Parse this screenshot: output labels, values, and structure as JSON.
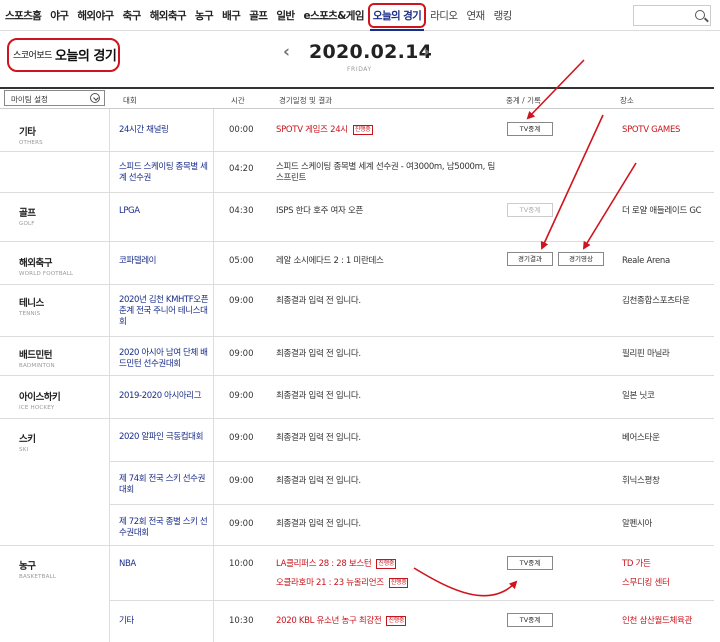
{
  "nav": {
    "items": [
      "스포츠홈",
      "야구",
      "해외야구",
      "축구",
      "해외축구",
      "농구",
      "배구",
      "골프",
      "일반",
      "e스포츠&게임"
    ],
    "active": "오늘의 경기",
    "after": [
      "라디오",
      "연재",
      "랭킹"
    ]
  },
  "header": {
    "scoreboard": "스코어보드",
    "title": "오늘의 경기",
    "date": "2020.02.14",
    "day": "FRIDAY"
  },
  "table": {
    "my_setting": "마이팀 설정",
    "columns": [
      "대회",
      "시간",
      "경기일정 및 결과",
      "중계 / 기록",
      "장소"
    ],
    "sports": [
      {
        "ko": "기타",
        "en": "OTHERS"
      },
      {
        "ko": "골프",
        "en": "GOLF"
      },
      {
        "ko": "해외축구",
        "en": "WORLD FOOTBALL"
      },
      {
        "ko": "테니스",
        "en": "TENNIS"
      },
      {
        "ko": "배드민턴",
        "en": "BADMINTON"
      },
      {
        "ko": "아이스하키",
        "en": "ICE HOCKEY"
      },
      {
        "ko": "스키",
        "en": "SKI"
      },
      {
        "ko": "농구",
        "en": "BASKETBALL"
      }
    ],
    "rows": [
      {
        "event": "24시간 채널링",
        "time": "00:00",
        "detail": "SPOTV 게임즈 24시",
        "live": "진행중",
        "button": "TV중계",
        "venue": "SPOTV GAMES"
      },
      {
        "event": "스피드 스케이팅 종목별 세계 선수권",
        "time": "04:20",
        "detail": "스피드 스케이팅 종목별 세계 선수권 - 여3000m, 남5000m, 팀스프린트",
        "venue": ""
      },
      {
        "event": "LPGA",
        "time": "04:30",
        "detail": "ISPS 한다 호주 여자 오픈",
        "button": "TV중계",
        "venue": "더 로얄 애들레이드 GC"
      },
      {
        "event": "코파델레이",
        "time": "05:00",
        "detail": "레알 소시에다드 2 : 1 미란데스",
        "button1": "경기결과",
        "button2": "경기영상",
        "venue": "Reale Arena"
      },
      {
        "event": "2020년 김천 KMHTF오픈 춘계 전국 주니어 테니스대회",
        "time": "09:00",
        "detail": "최종결과 입력 전 입니다.",
        "venue": "김천종합스포츠타운"
      },
      {
        "event": "2020 아시아 남여 단체 배드민턴 선수권대회",
        "time": "09:00",
        "detail": "최종결과 입력 전 입니다.",
        "venue": "필리핀 마닐라"
      },
      {
        "event": "2019-2020 아시아리그",
        "time": "09:00",
        "detail": "최종결과 입력 전 입니다.",
        "venue": "일본 닛코"
      },
      {
        "event": "2020 알파인 극동컵대회",
        "time": "09:00",
        "detail": "최종결과 입력 전 입니다.",
        "venue": "베어스타운"
      },
      {
        "event": "제 74회 전국 스키 선수권대회",
        "time": "09:00",
        "detail": "최종결과 입력 전 입니다.",
        "venue": "휘닉스평창"
      },
      {
        "event": "제 72회 전국 종별 스키 선수권대회",
        "time": "09:00",
        "detail": "최종결과 입력 전 입니다.",
        "venue": "알펜시아"
      },
      {
        "event": "NBA",
        "time": "10:00",
        "detail1": "LA클리퍼스 28 : 28 보스턴",
        "live1": "진행중",
        "detail2": "오클라호마 21 : 23 뉴올리언즈",
        "live2": "진행중",
        "button": "TV중계",
        "venue1": "TD 가든",
        "venue2": "스무디킹 센터"
      },
      {
        "event": "기타",
        "time": "10:30",
        "detail": "2020 KBL 유소년 농구 최강전",
        "live": "진행중",
        "button": "TV중계",
        "venue": "인천 삼산월드체육관"
      }
    ]
  },
  "colors": {
    "accent": "#1a2d8a",
    "live": "#c8141c",
    "annotation": "#d0141d"
  }
}
